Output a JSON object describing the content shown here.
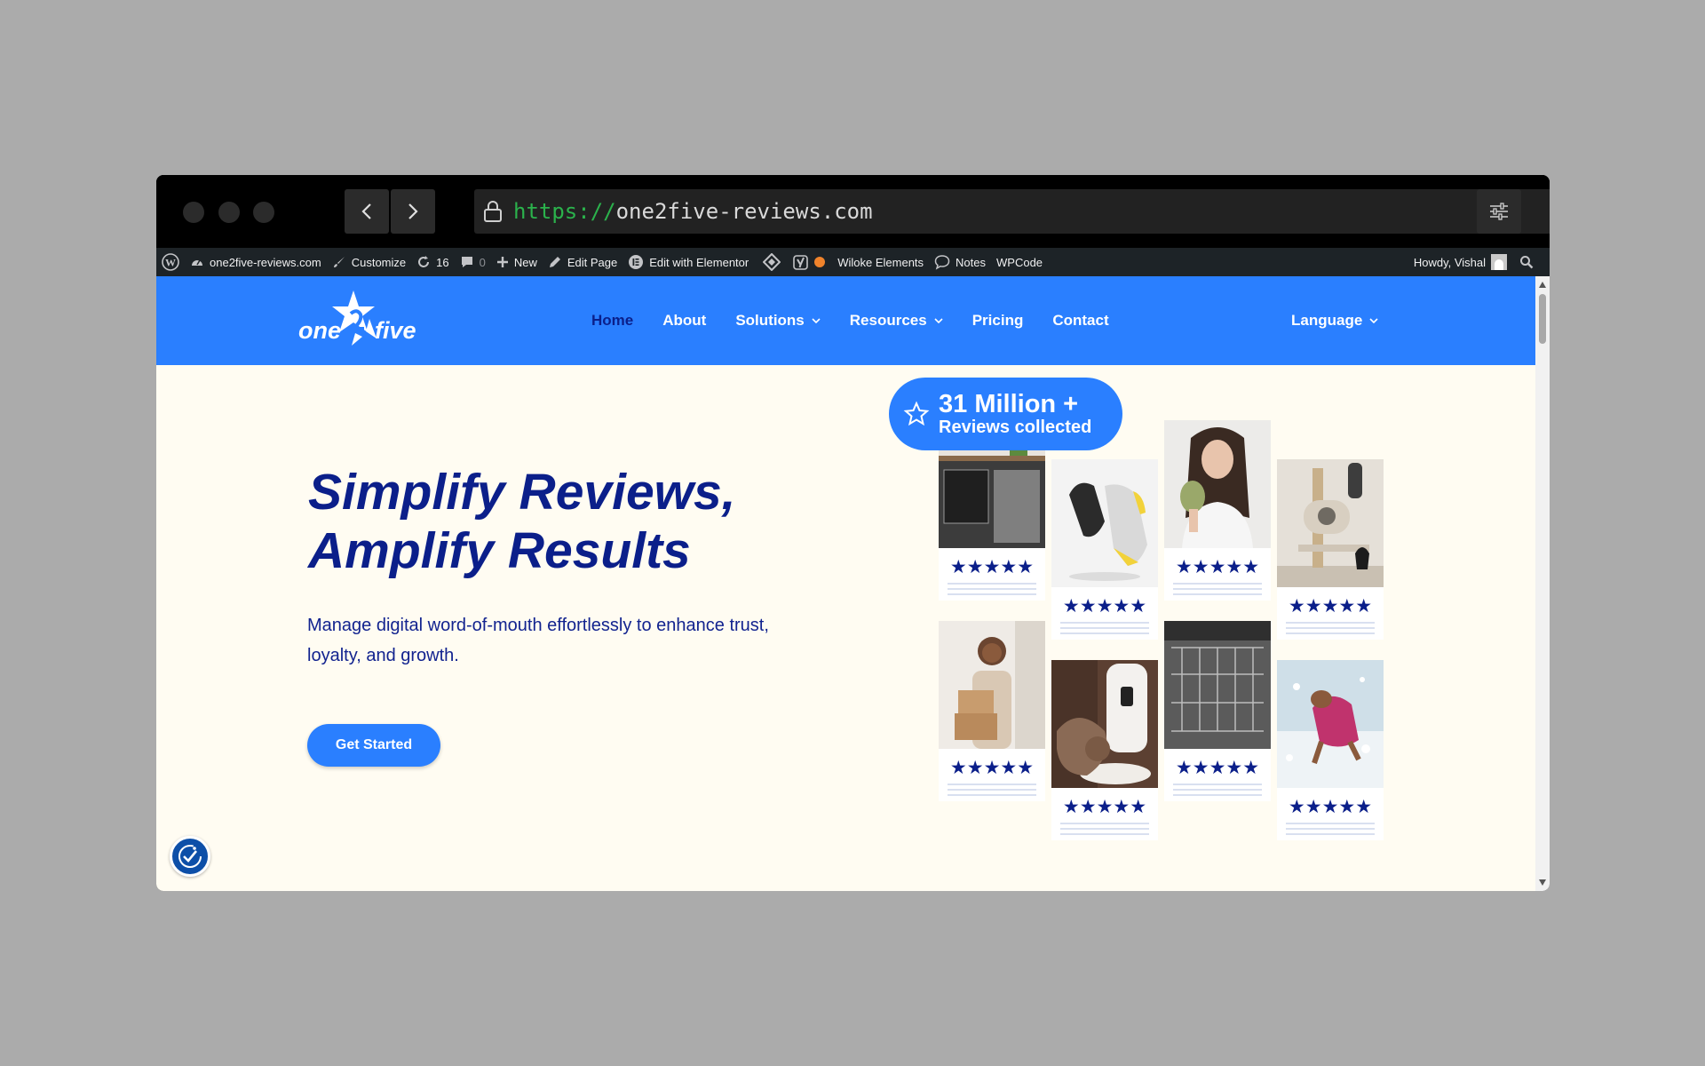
{
  "browser": {
    "url_protocol": "https://",
    "url_host": "one2five-reviews.com"
  },
  "adminbar": {
    "site_name": "one2five-reviews.com",
    "customize": "Customize",
    "updates_count": "16",
    "comments_count": "0",
    "new": "New",
    "edit_page": "Edit Page",
    "edit_elementor": "Edit with Elementor",
    "wiloke": "Wiloke Elements",
    "notes": "Notes",
    "wpcode": "WPCode",
    "howdy": "Howdy, Vishal"
  },
  "site": {
    "logo_alt": "one2five",
    "nav": [
      {
        "label": "Home"
      },
      {
        "label": "About"
      },
      {
        "label": "Solutions"
      },
      {
        "label": "Resources"
      },
      {
        "label": "Pricing"
      },
      {
        "label": "Contact"
      }
    ],
    "language": "Language"
  },
  "hero": {
    "title_line1": "Simplify Reviews,",
    "title_line2": "Amplify Results",
    "subtitle": "Manage digital word-of-mouth effortlessly to enhance trust, loyalty, and growth.",
    "cta": "Get Started"
  },
  "badge": {
    "title": "31 Million +",
    "subtitle": "Reviews collected"
  },
  "cards": [
    {
      "image": "kitchen-oven",
      "stars": "★★★★★"
    },
    {
      "image": "running-shoe",
      "stars": "★★★★★"
    },
    {
      "image": "woman-with-sponge",
      "stars": "★★★★★"
    },
    {
      "image": "cat-tree",
      "stars": "★★★★★"
    },
    {
      "image": "woman-with-boxes",
      "stars": "★★★★★"
    },
    {
      "image": "cat-feeder",
      "stars": "★★★★★"
    },
    {
      "image": "dishwasher-rack",
      "stars": "★★★★★"
    },
    {
      "image": "dog-in-snow",
      "stars": "★★★★★"
    }
  ],
  "colors": {
    "brand_blue": "#2a7fff",
    "navy": "#0b1f8a",
    "hero_bg": "#fffcf2",
    "adminbar_bg": "#1d2327"
  }
}
